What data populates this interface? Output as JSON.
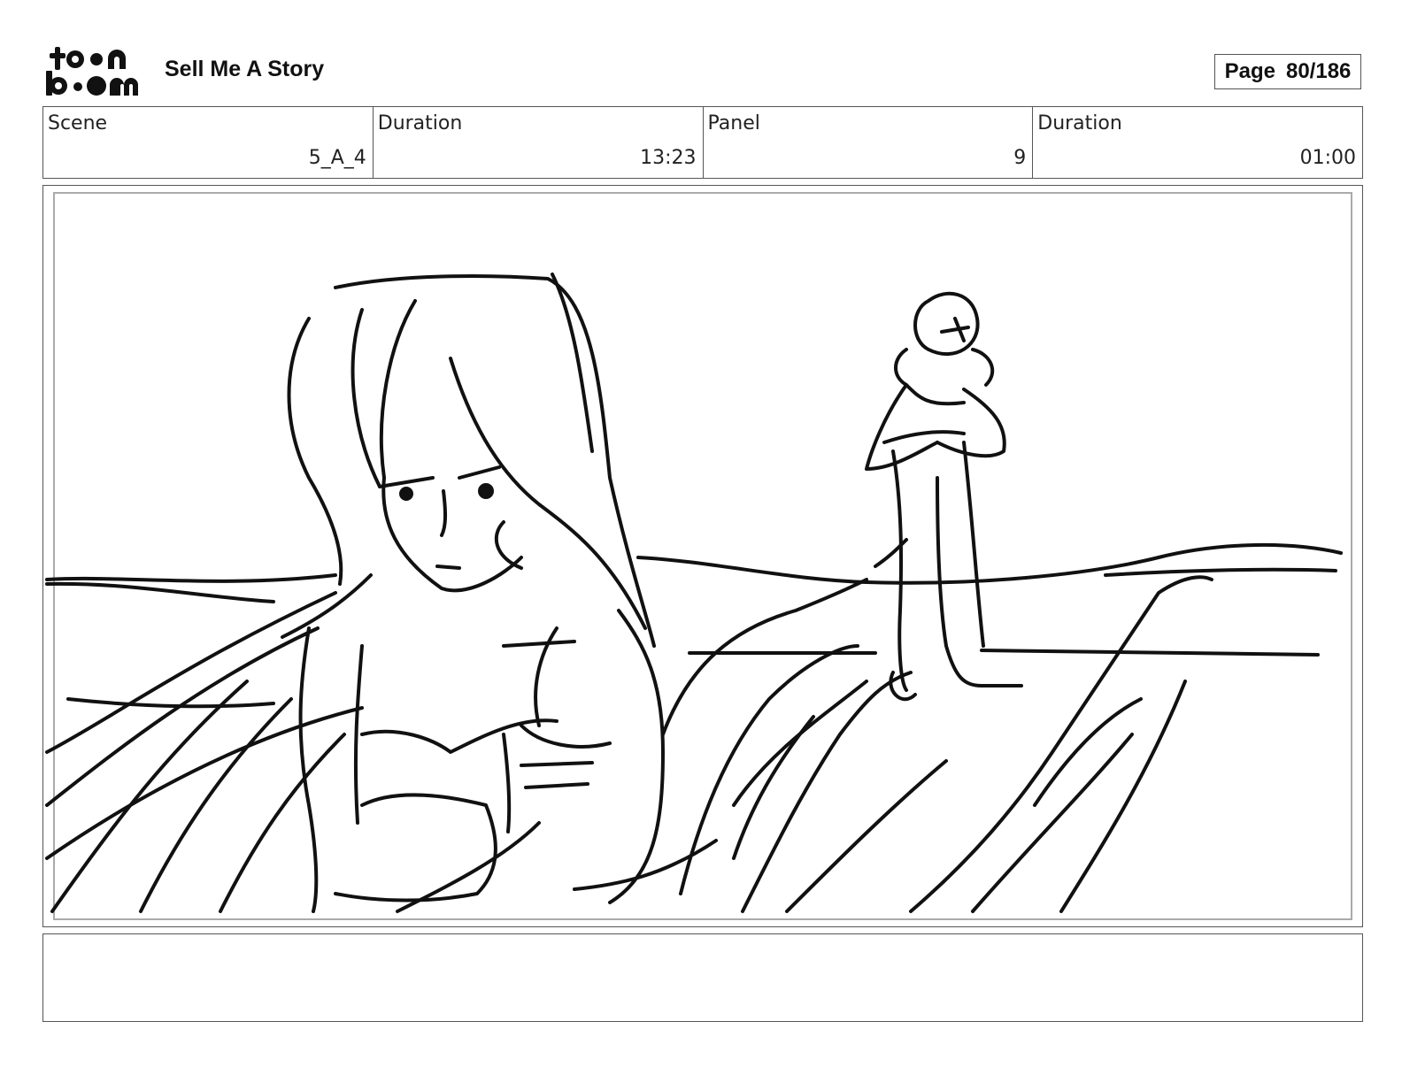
{
  "header": {
    "logo_line1": "toon",
    "logo_line2": "boom",
    "project_title": "Sell Me A Story",
    "page_label": "Page",
    "page_value": "80/186"
  },
  "info": {
    "scene_label": "Scene",
    "scene_value": "5_A_4",
    "scene_duration_label": "Duration",
    "scene_duration_value": "13:23",
    "panel_label": "Panel",
    "panel_value": "9",
    "panel_duration_label": "Duration",
    "panel_duration_value": "01:00"
  },
  "panel": {
    "image": "storyboard-sketch"
  },
  "notes": {
    "text": ""
  }
}
